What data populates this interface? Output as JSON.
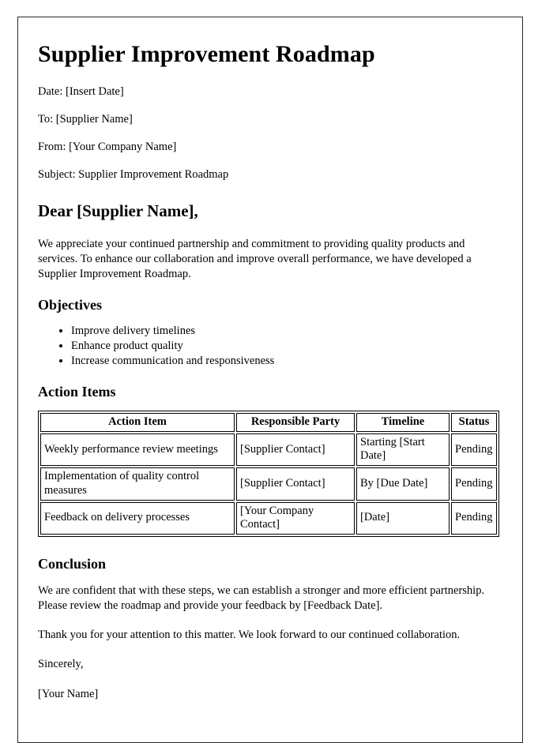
{
  "document": {
    "title": "Supplier Improvement Roadmap",
    "meta": [
      {
        "label": "Date:",
        "text": "Date: [Insert Date]"
      },
      {
        "label": "To:",
        "text": "To: [Supplier Name]"
      },
      {
        "label": "From:",
        "text": "From: [Your Company Name]"
      },
      {
        "label": "Subject:",
        "text": "Subject: Supplier Improvement Roadmap"
      }
    ],
    "salutation": "Dear [Supplier Name],",
    "intro_paragraph": "We appreciate your continued partnership and commitment to providing quality products and services. To enhance our collaboration and improve overall performance, we have developed a Supplier Improvement Roadmap.",
    "objectives": {
      "heading": "Objectives",
      "items": [
        "Improve delivery timelines",
        "Enhance product quality",
        "Increase communication and responsiveness"
      ]
    },
    "action_items": {
      "heading": "Action Items",
      "columns": [
        "Action Item",
        "Responsible Party",
        "Timeline",
        "Status"
      ],
      "rows": [
        {
          "action": "Weekly performance review meetings",
          "party": "[Supplier Contact]",
          "timeline": "Starting [Start Date]",
          "status": "Pending"
        },
        {
          "action": "Implementation of quality control measures",
          "party": "[Supplier Contact]",
          "timeline": "By [Due Date]",
          "status": "Pending"
        },
        {
          "action": "Feedback on delivery processes",
          "party": "[Your Company Contact]",
          "timeline": "[Date]",
          "status": "Pending"
        }
      ]
    },
    "conclusion": {
      "heading": "Conclusion",
      "paragraph_1": "We are confident that with these steps, we can establish a stronger and more efficient partnership. Please review the roadmap and provide your feedback by [Feedback Date].",
      "paragraph_2": "Thank you for your attention to this matter. We look forward to our continued collaboration."
    },
    "closing": {
      "sign_off": "Sincerely,",
      "signature": "[Your Name]"
    },
    "colors": {
      "page_border": "#2b2b2b",
      "text": "#000000",
      "background": "#ffffff",
      "table_border": "#000000"
    }
  }
}
